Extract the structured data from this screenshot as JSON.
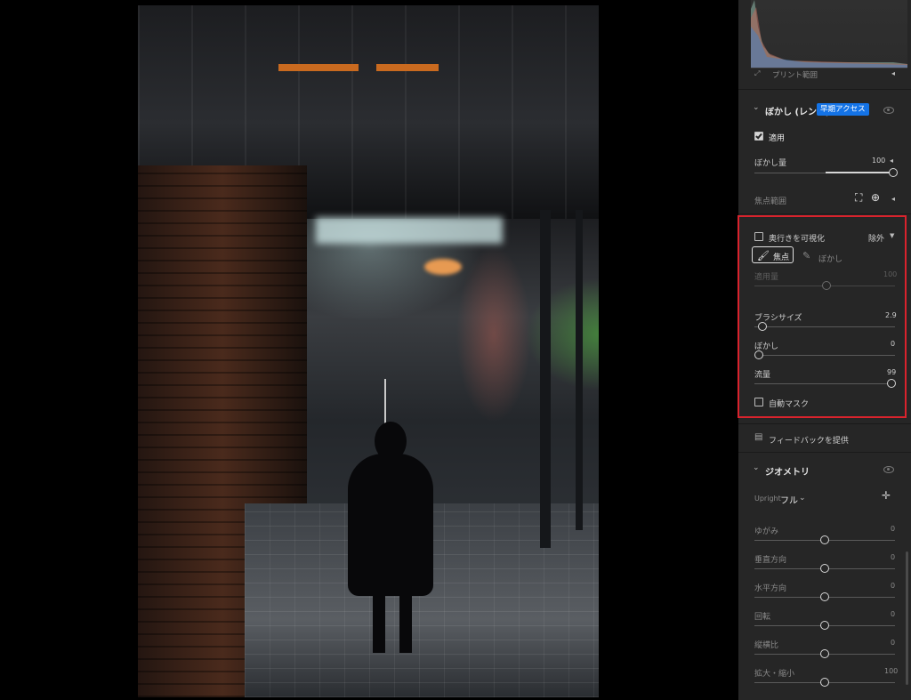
{
  "panel": {
    "histogram_footer": "プリント範囲",
    "lens_blur": {
      "title": "ぼかし (レンズ)",
      "badge": "早期アクセス",
      "apply_label": "適用",
      "apply_checked": true,
      "amount_label": "ぼかし量",
      "amount_value": "100",
      "amount_fraction": 1.0,
      "focal_range_label": "焦点範囲"
    },
    "refine": {
      "visualize_depth_label": "奥行きを可視化",
      "visualize_depth_checked": false,
      "mode_dropdown": "除外",
      "focus_button": "焦点",
      "blur_button": "ぼかし",
      "apply_amount_label": "適用量",
      "apply_amount_value": "100",
      "apply_amount_fraction": 0.5,
      "brush_size_label": "ブラシサイズ",
      "brush_size_value": "2.9",
      "brush_size_fraction": 0.05,
      "feather_label": "ぼかし",
      "feather_value": "0",
      "feather_fraction": 0.0,
      "flow_label": "流量",
      "flow_value": "99",
      "flow_fraction": 0.99,
      "auto_mask_label": "自動マスク",
      "auto_mask_checked": false
    },
    "feedback_label": "フィードバックを提供",
    "geometry": {
      "title": "ジオメトリ",
      "upright_label": "Upright",
      "upright_value": "フル",
      "sliders": [
        {
          "label": "ゆがみ",
          "value": "0",
          "fraction": 0.5
        },
        {
          "label": "垂直方向",
          "value": "0",
          "fraction": 0.5
        },
        {
          "label": "水平方向",
          "value": "0",
          "fraction": 0.5
        },
        {
          "label": "回転",
          "value": "0",
          "fraction": 0.5
        },
        {
          "label": "縦横比",
          "value": "0",
          "fraction": 0.5
        },
        {
          "label": "拡大・縮小",
          "value": "100",
          "fraction": 0.5
        }
      ]
    }
  },
  "colors": {
    "panel_bg": "#262626",
    "accent_badge": "#1473e6",
    "highlight_box": "#d9232d"
  },
  "icons": [
    "eye-icon",
    "checkmark-icon",
    "brush-icon",
    "person-focus-icon",
    "target-icon",
    "feedback-icon",
    "upright-adjust-icon",
    "chevron-down-icon"
  ]
}
